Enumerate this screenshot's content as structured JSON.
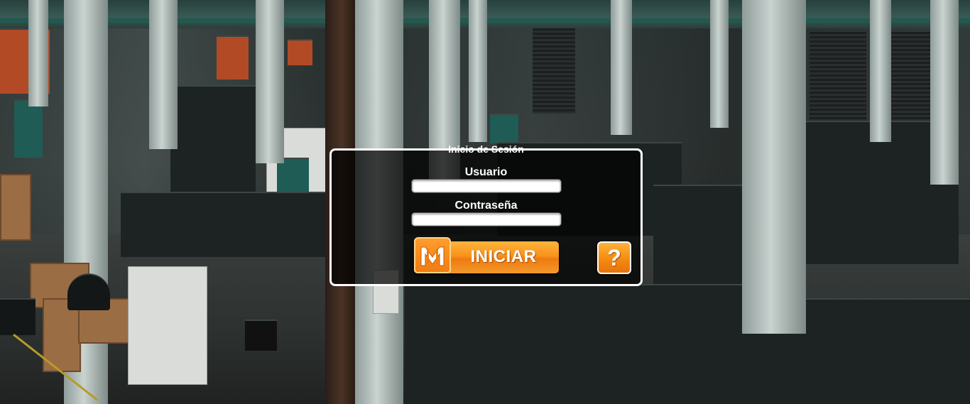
{
  "login": {
    "legend": "Inicio de Sesión",
    "username_label": "Usuario",
    "username_value": "",
    "password_label": "Contraseña",
    "password_value": "",
    "submit_label": "INICIAR",
    "help_label": "?"
  },
  "colors": {
    "accent": "#f7931e",
    "panel_border": "#ffffff",
    "panel_background": "#000000"
  },
  "icons": {
    "logo": "metro-logo-icon",
    "help": "question-mark-icon"
  }
}
